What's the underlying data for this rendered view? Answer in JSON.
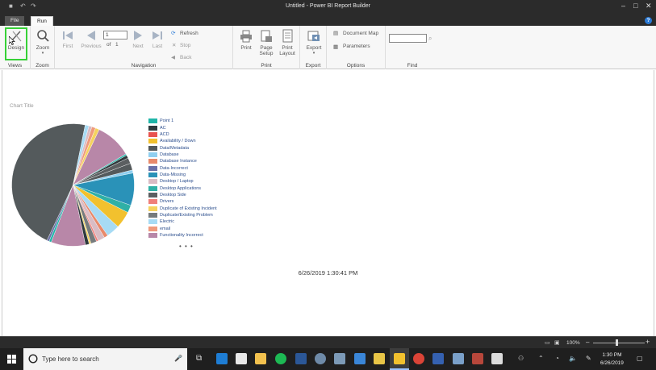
{
  "window": {
    "title": "Untitled - Power BI Report Builder",
    "minimize": "–",
    "maximize": "□",
    "close": "✕"
  },
  "tabs": {
    "file": "File",
    "run": "Run"
  },
  "ribbon": {
    "views": {
      "design": "Design",
      "group": "Views"
    },
    "zoom": {
      "zoom": "Zoom",
      "group": "Zoom"
    },
    "navigation": {
      "first": "First",
      "previous": "Previous",
      "page_value": "1",
      "of_label": "of",
      "total_pages": "1",
      "next": "Next",
      "last": "Last",
      "refresh": "Refresh",
      "stop": "Stop",
      "back": "Back",
      "group": "Navigation"
    },
    "print": {
      "print": "Print",
      "page_setup_1": "Page",
      "page_setup_2": "Setup",
      "print_layout_1": "Print",
      "print_layout_2": "Layout",
      "group": "Print"
    },
    "export": {
      "export": "Export",
      "group": "Export"
    },
    "options": {
      "document_map": "Document Map",
      "parameters": "Parameters",
      "group": "Options"
    },
    "find": {
      "group": "Find",
      "value": ""
    }
  },
  "report": {
    "chart_title": "Chart Title",
    "timestamp": "6/26/2019 1:30:41 PM",
    "more": "• • •"
  },
  "chart_data": {
    "type": "pie",
    "title": "Chart Title",
    "legend_position": "right",
    "legend": [
      {
        "label": "Point 1",
        "color": "#1fb5a8"
      },
      {
        "label": "AC",
        "color": "#2f3a3d"
      },
      {
        "label": "ACD",
        "color": "#e8534f"
      },
      {
        "label": "Availability / Down",
        "color": "#f2c12e"
      },
      {
        "label": "Data/Metadata",
        "color": "#545a5c"
      },
      {
        "label": "Database",
        "color": "#8fcff0"
      },
      {
        "label": "Database Instance",
        "color": "#e88a6b"
      },
      {
        "label": "Data-Incorrect",
        "color": "#6a70a8"
      },
      {
        "label": "Data-Missing",
        "color": "#2a92b8"
      },
      {
        "label": "Desktop / Laptop",
        "color": "#d9bcc4"
      },
      {
        "label": "Desktop Applications",
        "color": "#2fb0a6"
      },
      {
        "label": "Desktop Side",
        "color": "#5b5f61"
      },
      {
        "label": "Drivers",
        "color": "#ef7f7a"
      },
      {
        "label": "Duplicate of Existing Incident",
        "color": "#f5d25e"
      },
      {
        "label": "Duplicate/Existing Problem",
        "color": "#767b7d"
      },
      {
        "label": "Electric",
        "color": "#a7dbf4"
      },
      {
        "label": "email",
        "color": "#ef9a7c"
      },
      {
        "label": "Functionality Incorrect",
        "color": "#b887a8"
      }
    ],
    "slices": [
      {
        "label": "Functionality Incorrect",
        "value": 9.5,
        "color": "#b887a8"
      },
      {
        "label": "Point 1",
        "value": 0.4,
        "color": "#1fb5a8"
      },
      {
        "label": "AC",
        "value": 0.8,
        "color": "#2f3a3d"
      },
      {
        "label": "Desktop Side",
        "value": 1.5,
        "color": "#5b5f61"
      },
      {
        "label": "Data/Metadata",
        "value": 1.8,
        "color": "#545a5c"
      },
      {
        "label": "Database",
        "value": 0.8,
        "color": "#8fcff0"
      },
      {
        "label": "Data-Missing",
        "value": 8.5,
        "color": "#2a92b8"
      },
      {
        "label": "Desktop Applications",
        "value": 2.0,
        "color": "#2fb0a6"
      },
      {
        "label": "Availability / Down",
        "value": 4.5,
        "color": "#f2c12e"
      },
      {
        "label": "Electric",
        "value": 3.5,
        "color": "#a7dbf4"
      },
      {
        "label": "Database Instance",
        "value": 1.0,
        "color": "#e88a6b"
      },
      {
        "label": "Desktop / Laptop",
        "value": 1.8,
        "color": "#d9bcc4"
      },
      {
        "label": "Drivers",
        "value": 0.5,
        "color": "#ef7f7a"
      },
      {
        "label": "Duplicate/Existing Problem",
        "value": 1.5,
        "color": "#767b7d"
      },
      {
        "label": "Duplicate of Existing Incident",
        "value": 0.5,
        "color": "#f5d25e"
      },
      {
        "label": "AC",
        "value": 1.0,
        "color": "#2f3a3d"
      },
      {
        "label": "Functionality Incorrect",
        "value": 9.0,
        "color": "#b887a8"
      },
      {
        "label": "Point 1",
        "value": 0.6,
        "color": "#1fb5a8"
      },
      {
        "label": "Data-Incorrect",
        "value": 0.6,
        "color": "#6a70a8"
      },
      {
        "label": "Data/Metadata",
        "value": 46.0,
        "color": "#545a5c"
      },
      {
        "label": "Electric",
        "value": 1.0,
        "color": "#a7dbf4"
      },
      {
        "label": "Desktop / Laptop",
        "value": 0.8,
        "color": "#d9bcc4"
      },
      {
        "label": "email",
        "value": 1.0,
        "color": "#ef9a7c"
      },
      {
        "label": "Duplicate of Existing Incident",
        "value": 1.0,
        "color": "#f5d25e"
      }
    ]
  },
  "statusbar": {
    "zoom": "100%"
  },
  "taskbar": {
    "search_placeholder": "Type here to search",
    "time": "1:30 PM",
    "date": "6/26/2019"
  }
}
